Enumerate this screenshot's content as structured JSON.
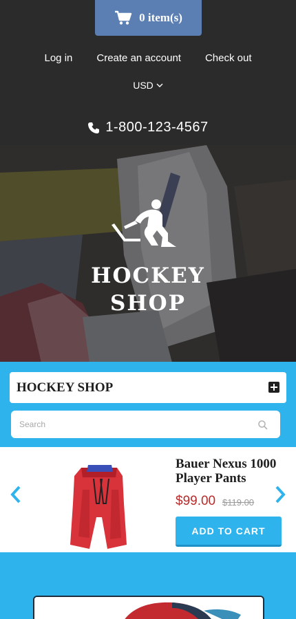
{
  "header": {
    "cart_label": "0 item(s)",
    "nav": [
      "Log in",
      "Create an account",
      "Check out"
    ],
    "currency": "USD",
    "phone": "1-800-123-4567"
  },
  "hero": {
    "title_line1": "HOCKEY",
    "title_line2": "SHOP"
  },
  "shop_box": {
    "title": "HOCKEY SHOP"
  },
  "search": {
    "placeholder": "Search"
  },
  "product": {
    "name": "Bauer Nexus 1000 Player Pants",
    "price": "$99.00",
    "old_price": "$119.00",
    "add_to_cart": "ADD TO CART"
  },
  "colors": {
    "topbar_bg": "#2b2b2b",
    "cart_button": "#5b7fb3",
    "accent_blue": "#2fb3ec",
    "price_red": "#b72b2b"
  }
}
